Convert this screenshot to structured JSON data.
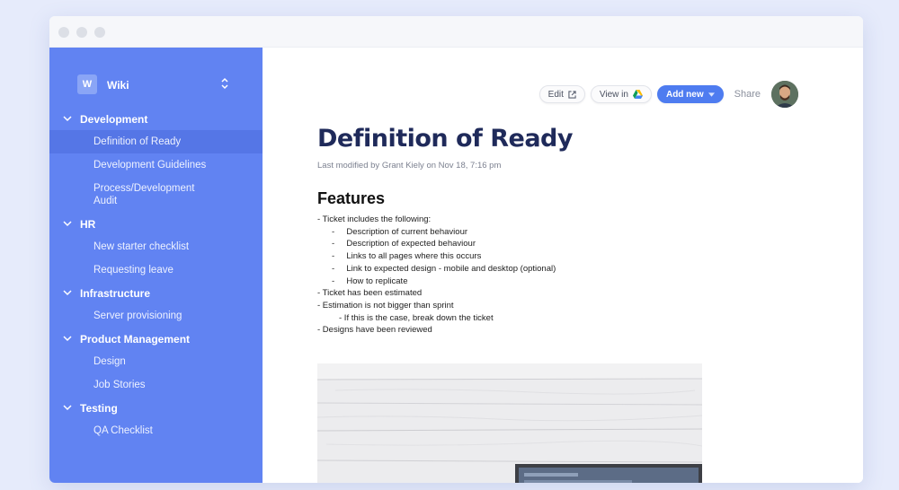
{
  "workspace": {
    "badge": "W",
    "name": "Wiki"
  },
  "sidebar": {
    "groups": [
      {
        "label": "Development",
        "items": [
          "Definition of Ready",
          "Development Guidelines",
          "Process/Development Audit"
        ]
      },
      {
        "label": "HR",
        "items": [
          "New starter checklist",
          "Requesting leave"
        ]
      },
      {
        "label": "Infrastructure",
        "items": [
          "Server provisioning"
        ]
      },
      {
        "label": "Product Management",
        "items": [
          "Design",
          "Job Stories"
        ]
      },
      {
        "label": "Testing",
        "items": [
          "QA Checklist"
        ]
      }
    ]
  },
  "toolbar": {
    "edit_label": "Edit",
    "view_in_label": "View in",
    "add_new_label": "Add new",
    "share_label": "Share"
  },
  "doc": {
    "title": "Definition of Ready",
    "meta": "Last modified by Grant Kiely on Nov 18, 7:16 pm",
    "section_title": "Features",
    "lines": [
      {
        "level": 1,
        "text": "- Ticket includes the following:"
      },
      {
        "level": 2,
        "text": "-     Description of current behaviour"
      },
      {
        "level": 2,
        "text": "-     Description of expected behaviour"
      },
      {
        "level": 2,
        "text": "-     Links to all pages where this occurs"
      },
      {
        "level": 2,
        "text": "-     Link to expected design - mobile and desktop (optional)"
      },
      {
        "level": 2,
        "text": "-     How to replicate"
      },
      {
        "level": 1,
        "text": "- Ticket has been estimated"
      },
      {
        "level": 1,
        "text": "- Estimation is not bigger than sprint"
      },
      {
        "level": 3,
        "text": "- If this is the case, break down the ticket"
      },
      {
        "level": 1,
        "text": "- Designs have been reviewed"
      }
    ]
  },
  "colors": {
    "sidebar_bg": "#6183f2",
    "sidebar_active": "#5576e6",
    "primary_button": "#4e7cf0",
    "title_text": "#1f2a5a"
  },
  "icons": {
    "window_controls": "traffic-light-dots",
    "group_toggle": "chevron-down-icon",
    "workspace_switch": "up-down-chevron-icon",
    "edit": "external-link-icon",
    "view_in": "google-drive-icon",
    "add_new": "caret-down-icon"
  }
}
